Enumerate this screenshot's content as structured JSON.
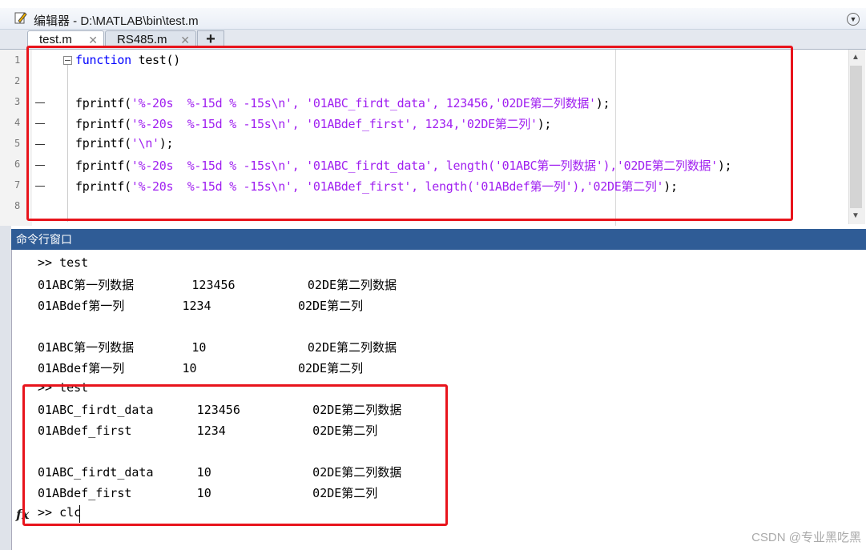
{
  "editor": {
    "title": "编辑器 - D:\\MATLAB\\bin\\test.m",
    "tabs": [
      {
        "label": "test.m",
        "close": "✕"
      },
      {
        "label": "RS485.m",
        "close": "✕"
      }
    ],
    "add_tab": "+",
    "line_numbers": [
      "1",
      "2",
      "3",
      "4",
      "5",
      "6",
      "7",
      "8"
    ],
    "code": [
      {
        "kw": "function",
        "rest": " test()"
      },
      {
        "a": "",
        "s": "",
        "b": ""
      },
      {
        "a": "fprintf(",
        "s": "'%-20s  %-15d % -15s\\n', '01ABC_firdt_data', 123456,'02DE第二列数据'",
        "b": ");"
      },
      {
        "a": "fprintf(",
        "s": "'%-20s  %-15d % -15s\\n', '01ABdef_first', 1234,'02DE第二列'",
        "b": ");"
      },
      {
        "a": "fprintf(",
        "s": "'\\n'",
        "b": ");"
      },
      {
        "a": "fprintf(",
        "s": "'%-20s  %-15d % -15s\\n', '01ABC_firdt_data', length('01ABC第一列数据'),'02DE第二列数据'",
        "b": ");"
      },
      {
        "a": "fprintf(",
        "s": "'%-20s  %-15d % -15s\\n', '01ABdef_first', length('01ABdef第一列'),'02DE第二列'",
        "b": ");"
      }
    ]
  },
  "command_window": {
    "title": "命令行窗口",
    "fx_symbol": "fx",
    "lines": [
      ">> test",
      "01ABC第一列数据        123456          02DE第二列数据",
      "01ABdef第一列        1234            02DE第二列",
      "",
      "01ABC第一列数据        10              02DE第二列数据",
      "01ABdef第一列        10              02DE第二列",
      ">> test",
      "01ABC_firdt_data      123456          02DE第二列数据",
      "01ABdef_first         1234            02DE第二列",
      "",
      "01ABC_firdt_data      10              02DE第二列数据",
      "01ABdef_first         10              02DE第二列",
      ">> clc"
    ]
  },
  "watermark": "CSDN @专业黑吃黑",
  "colors": {
    "keyword": "#0000ff",
    "string": "#a020f0",
    "highlight_box": "#e8141c",
    "cmd_header": "#2f5c96"
  }
}
